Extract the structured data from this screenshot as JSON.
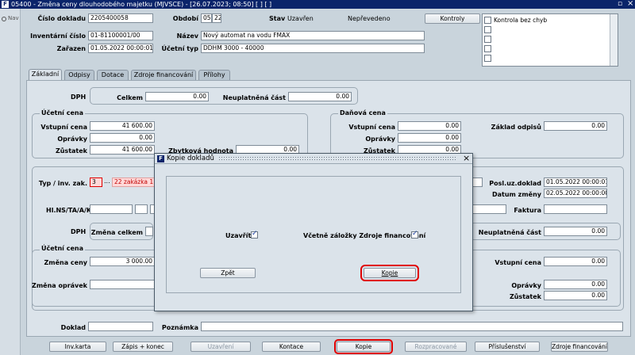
{
  "window": {
    "title": "05400 - Změna ceny dlouhodobého majetku (MJVSCE) - [26.07.2023; 08:50] [ ] [ ]",
    "restore_glyph": "▫",
    "close_glyph": "×"
  },
  "nav": {
    "label": "Nav"
  },
  "header": {
    "doc_number_label": "Číslo dokladu",
    "doc_number": "2205400058",
    "period_label": "Období",
    "period_a": "05",
    "period_b": "22",
    "status_label": "Stav",
    "status_value": "Uzavřen",
    "posting_value": "Nepřevedeno",
    "controls_button": "Kontroly",
    "inventory_label": "Inventární číslo",
    "inventory": "01-81100001/00",
    "name_label": "Název",
    "name": "Nový automat na vodu FMAX",
    "included_label": "Zařazen",
    "included": "01.05.2022 00:00:01",
    "acc_type_label": "Účetní typ",
    "acc_type": "DDHM 3000 - 40000",
    "check_item": "Kontrola bez chyb"
  },
  "tabs": [
    "Základní",
    "Odpisy",
    "Dotace",
    "Zdroje financování",
    "Přílohy"
  ],
  "form": {
    "dph_label": "DPH",
    "total_label": "Celkem",
    "total": "0.00",
    "unclaimed_label": "Neuplatněná část",
    "unclaimed": "0.00",
    "acc_price_title": "Účetní cena",
    "tax_price_title": "Daňová cena",
    "entry_price_label": "Vstupní cena",
    "entry_price": "41 600.00",
    "corrections_label": "Oprávky",
    "corrections": "0.00",
    "balance_label": "Zůstatek",
    "balance": "41 600.00",
    "residual_label": "Zbytková hodnota",
    "residual": "0.00",
    "tax_entry_price": "0.00",
    "tax_corrections": "0.00",
    "tax_balance": "0.00",
    "tax_base_label": "Základ odpisů",
    "tax_base": "0.00",
    "type_label": "Typ / inv. zak.",
    "type_value": "3",
    "ellipsis": "...",
    "order_value": "22 zakázka 1",
    "last_doc_label": "Posl.uz.doklad",
    "last_doc": "01.05.2022 00:00:01",
    "change_date_label": "Datum změny",
    "change_date": "02.05.2022 00:00:00",
    "hlns_label": "Hl.NS/TA/A/KP",
    "invoice_label": "Faktura",
    "dph2_label": "DPH",
    "change_total_label": "Změna celkem",
    "unclaimed2_label": "Neuplatněná část",
    "unclaimed2": "0.00",
    "acc_price2_title": "Účetní cena",
    "price_change_label": "Změna ceny",
    "price_change": "3 000.00",
    "corr_change_label": "Změna oprávek",
    "entry_price2_label": "Vstupní cena",
    "entry_price2": "0.00",
    "corrections2_label": "Oprávky",
    "corrections2": "0.00",
    "balance2_label": "Zůstatek",
    "balance2": "0.00",
    "document_label": "Doklad",
    "note_label": "Poznámka"
  },
  "dialog": {
    "title": "Kopie dokladů",
    "close_glyph": "×",
    "close_label": "Uzavřít",
    "include_label": "Včetně záložky Zdroje financování",
    "back_button": "Zpět",
    "copy_button": "Kopie"
  },
  "bottom_bar": {
    "inv_card": "Inv.karta",
    "write_end": "Zápis + konec",
    "closings": "Uzavření",
    "contact": "Kontace",
    "copy": "Kopie",
    "distribute": "Rozpracované",
    "accessories": "Příslušenství",
    "funding": "Zdroje financování"
  },
  "colors": {
    "highlight": "#e00000",
    "title_bg": "#0a246a",
    "panel_bg": "#dbe3ea"
  }
}
